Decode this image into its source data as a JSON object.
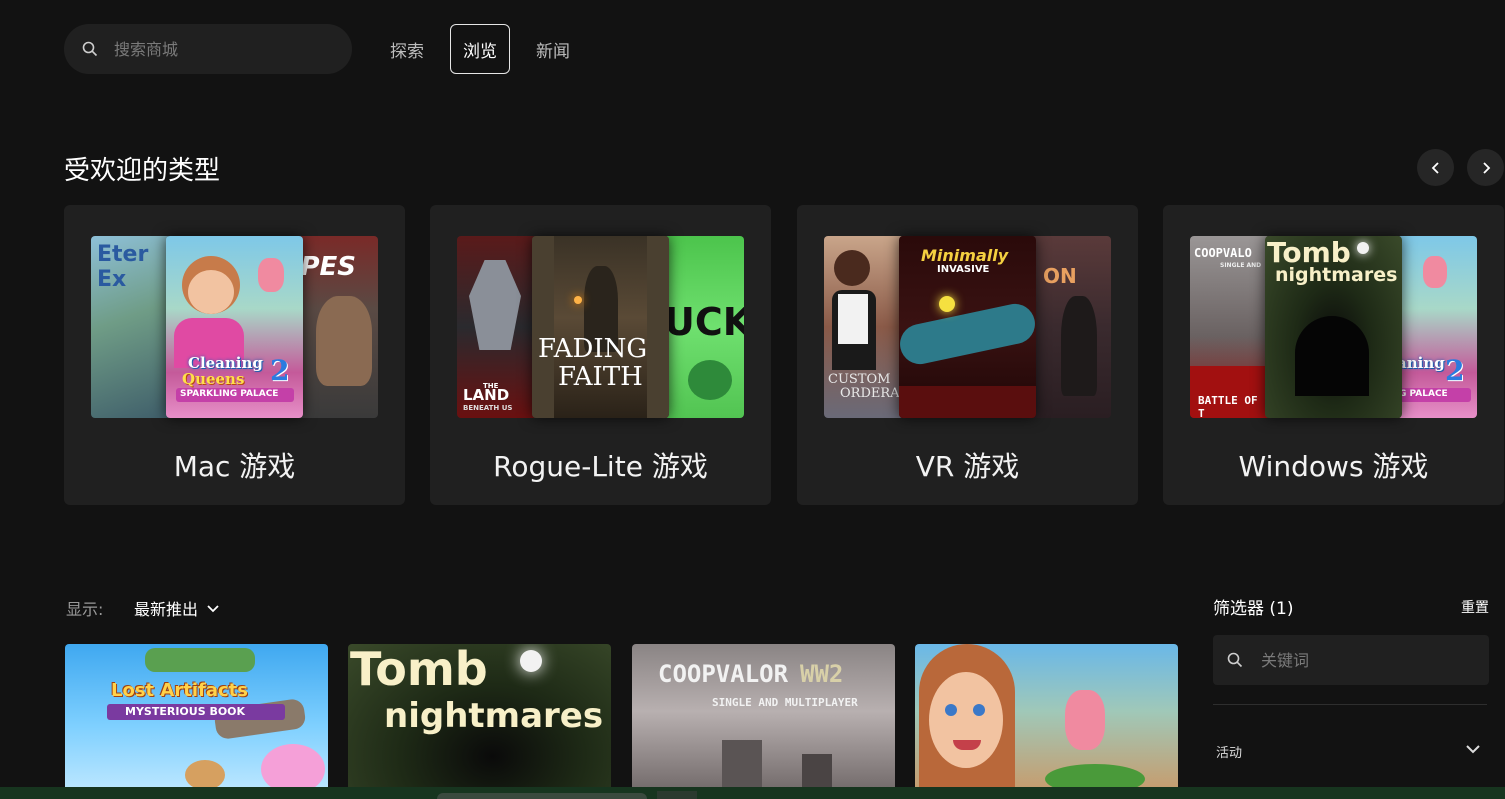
{
  "nav": {
    "search_placeholder": "搜索商城",
    "tabs": [
      {
        "label": "探索",
        "active": false
      },
      {
        "label": "浏览",
        "active": true
      },
      {
        "label": "新闻",
        "active": false
      }
    ]
  },
  "popular_genres": {
    "title": "受欢迎的类型",
    "genres": [
      {
        "label": "Mac 游戏",
        "thumbs": {
          "left": "Eter Ex",
          "center_line1": "Cleaning",
          "center_line2": "Queens",
          "center_num": "2",
          "center_sub": "SPARKLING PALACE",
          "right": "PES"
        }
      },
      {
        "label": "Rogue-Lite 游戏",
        "thumbs": {
          "left_line1": "THE",
          "left_line2": "LAND",
          "left_line3": "BENEATH US",
          "center_line1": "FADING",
          "center_line2": "FAITH",
          "right": "UCK"
        }
      },
      {
        "label": "VR 游戏",
        "thumbs": {
          "left_line1": "CUSTOM",
          "left_line2": "ORDERA",
          "center_line1": "Minimally",
          "center_line2": "INVASIVE",
          "right": "ON"
        }
      },
      {
        "label": "Windows 游戏",
        "thumbs": {
          "left_line1": "COOPVALO",
          "left_line2": "SINGLE AND",
          "left_line3": "BATTLE OF T",
          "center_line1": "Tomb",
          "center_line2": "nightmares",
          "right_line1": "aning",
          "right_num": "2",
          "right_sub": "G PALACE"
        }
      }
    ]
  },
  "listing": {
    "show_label": "显示:",
    "sort_value": "最新推出",
    "games": [
      {
        "line1": "Lost Artifacts",
        "line2": "MYSTERIOUS BOOK"
      },
      {
        "line1": "Tomb",
        "line2": "nightmares"
      },
      {
        "line1": "COOPVALOR",
        "line1b": "WW2",
        "line2": "SINGLE AND MULTIPLAYER"
      },
      {
        "line1": ""
      }
    ]
  },
  "filters": {
    "title": "筛选器 (1)",
    "reset": "重置",
    "keyword_placeholder": "关键词",
    "sections": [
      {
        "label": "活动"
      }
    ]
  },
  "colors": {
    "background": "#121212",
    "card": "#202020",
    "bottom_bar": "#17351f"
  }
}
